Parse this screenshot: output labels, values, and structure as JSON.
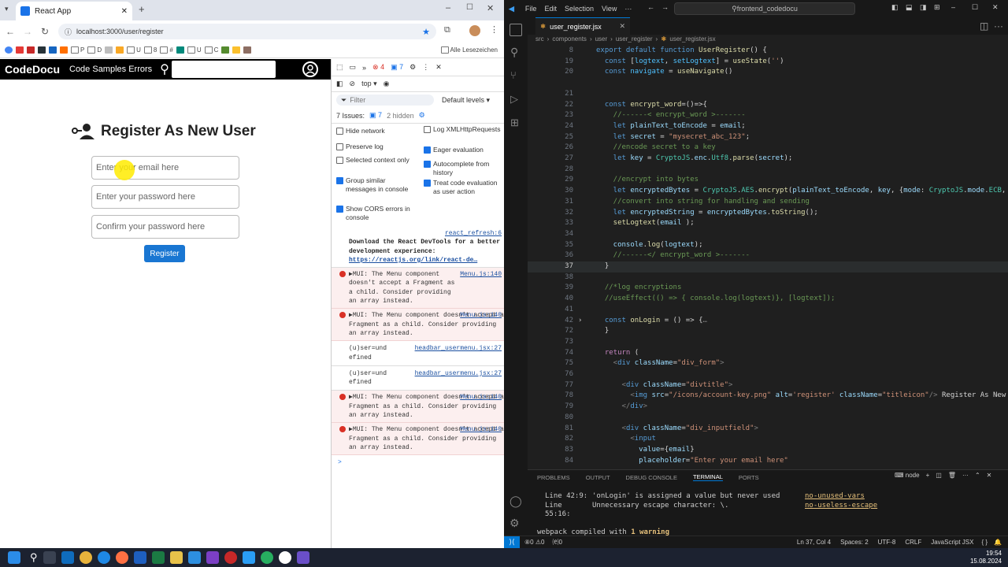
{
  "browser": {
    "tab_title": "React App",
    "url": "localhost:3000/user/register",
    "bookmarks": [
      "P",
      "D",
      "U",
      "8",
      "#",
      "U",
      "C"
    ],
    "all_bookmarks_label": "Alle Lesezeichen"
  },
  "app": {
    "brand": "CodeDocu",
    "nav_link": "Code Samples Errors",
    "register_title": "Register As New User",
    "email_placeholder": "Enter your email here",
    "password_placeholder": "Enter your password here",
    "confirm_placeholder": "Confirm your password here",
    "register_button": "Register"
  },
  "devtools": {
    "errors_count": "4",
    "messages_count": "7",
    "context": "top",
    "filter_placeholder": "Filter",
    "levels": "Default levels",
    "issues_label": "7 Issues:",
    "issues_count": "7",
    "hidden_label": "2 hidden",
    "options_left": [
      {
        "label": "Hide network",
        "checked": false
      },
      {
        "label": "Preserve log",
        "checked": false
      },
      {
        "label": "Selected context only",
        "checked": false
      },
      {
        "label": "Group similar messages in console",
        "checked": true
      },
      {
        "label": "Show CORS errors in console",
        "checked": true
      }
    ],
    "options_right": [
      {
        "label": "Log XMLHttpRequests",
        "checked": false
      },
      {
        "label": "Eager evaluation",
        "checked": true
      },
      {
        "label": "Autocomplete from history",
        "checked": true
      },
      {
        "label": "Treat code evaluation as user action",
        "checked": true
      }
    ],
    "console": {
      "info_src": "react_refresh:6",
      "info_text": "Download the React DevTools for a better development experience:",
      "info_link": "https://reactjs.org/link/react-de…",
      "mui_text": "▶MUI: The Menu component doesn't accept a Fragment as a child. Consider providing an array instead.",
      "mui_src": "Menu.js:140",
      "user_text": "(u)ser=und efined",
      "user_src": "headbar_usermenu.jsx:27",
      "prompt": ">"
    }
  },
  "vscode": {
    "menu": [
      "File",
      "Edit",
      "Selection",
      "View"
    ],
    "command_center": "frontend_codedocu",
    "tab": "user_register.jsx",
    "breadcrumb": [
      "src",
      "components",
      "user",
      "user_register",
      "user_register.jsx"
    ],
    "code_lines": [
      {
        "n": "8",
        "t": [
          [
            "kw",
            "export default function "
          ],
          [
            "fn",
            "UserRegister"
          ],
          [
            "pun",
            "() {"
          ]
        ]
      },
      {
        "n": "19",
        "t": [
          [
            "kw",
            "  const "
          ],
          [
            "pun",
            "["
          ],
          [
            "con",
            "logtext"
          ],
          [
            "pun",
            ", "
          ],
          [
            "con",
            "setLogtext"
          ],
          [
            "pun",
            "] = "
          ],
          [
            "fn",
            "useState"
          ],
          [
            "pun",
            "("
          ],
          [
            "str",
            "''"
          ],
          [
            "pun",
            ")"
          ]
        ]
      },
      {
        "n": "20",
        "t": [
          [
            "kw",
            "  const "
          ],
          [
            "con",
            "navigate"
          ],
          [
            "pun",
            " = "
          ],
          [
            "fn",
            "useNavigate"
          ],
          [
            "pun",
            "()"
          ]
        ]
      },
      {
        "n": "",
        "t": []
      },
      {
        "n": "21",
        "t": []
      },
      {
        "n": "22",
        "t": [
          [
            "kw",
            "  const "
          ],
          [
            "fn",
            "encrypt_word"
          ],
          [
            "pun",
            "=()=>{"
          ]
        ]
      },
      {
        "n": "23",
        "t": [
          [
            "cm",
            "    //------< encrypt_word >-------"
          ]
        ]
      },
      {
        "n": "24",
        "t": [
          [
            "kw",
            "    let "
          ],
          [
            "var",
            "plainText_toEncode"
          ],
          [
            "pun",
            " = "
          ],
          [
            "var",
            "email"
          ],
          [
            "pun",
            ";"
          ]
        ]
      },
      {
        "n": "25",
        "t": [
          [
            "kw",
            "    let "
          ],
          [
            "var",
            "secret"
          ],
          [
            "pun",
            " = "
          ],
          [
            "str",
            "\"mysecret_abc_123\""
          ],
          [
            "pun",
            ";"
          ]
        ]
      },
      {
        "n": "26",
        "t": [
          [
            "cm",
            "    //encode secret to a key"
          ]
        ]
      },
      {
        "n": "27",
        "t": [
          [
            "kw",
            "    let "
          ],
          [
            "var",
            "key"
          ],
          [
            "pun",
            " = "
          ],
          [
            "cls",
            "CryptoJS"
          ],
          [
            "pun",
            "."
          ],
          [
            "var",
            "enc"
          ],
          [
            "pun",
            "."
          ],
          [
            "cls",
            "Utf8"
          ],
          [
            "pun",
            "."
          ],
          [
            "fn",
            "parse"
          ],
          [
            "pun",
            "("
          ],
          [
            "var",
            "secret"
          ],
          [
            "pun",
            ");"
          ]
        ]
      },
      {
        "n": "28",
        "t": []
      },
      {
        "n": "29",
        "t": [
          [
            "cm",
            "    //encrypt into bytes"
          ]
        ]
      },
      {
        "n": "30",
        "t": [
          [
            "kw",
            "    let "
          ],
          [
            "var",
            "encryptedBytes"
          ],
          [
            "pun",
            " = "
          ],
          [
            "cls",
            "CryptoJS"
          ],
          [
            "pun",
            "."
          ],
          [
            "cls",
            "AES"
          ],
          [
            "pun",
            "."
          ],
          [
            "fn",
            "encrypt"
          ],
          [
            "pun",
            "("
          ],
          [
            "var",
            "plainText_toEncode"
          ],
          [
            "pun",
            ", "
          ],
          [
            "var",
            "key"
          ],
          [
            "pun",
            ", {"
          ],
          [
            "var",
            "mode"
          ],
          [
            "pun",
            ": "
          ],
          [
            "cls",
            "CryptoJS"
          ],
          [
            "pun",
            "."
          ],
          [
            "var",
            "mode"
          ],
          [
            "pun",
            "."
          ],
          [
            "cls",
            "ECB"
          ],
          [
            "pun",
            ", "
          ],
          [
            "var",
            "paddi"
          ]
        ]
      },
      {
        "n": "31",
        "t": [
          [
            "cm",
            "    //convert into string for handling and sending"
          ]
        ]
      },
      {
        "n": "32",
        "t": [
          [
            "kw",
            "    let "
          ],
          [
            "var",
            "encryptedString"
          ],
          [
            "pun",
            " = "
          ],
          [
            "var",
            "encryptedBytes"
          ],
          [
            "pun",
            "."
          ],
          [
            "fn",
            "toString"
          ],
          [
            "pun",
            "();"
          ]
        ]
      },
      {
        "n": "33",
        "t": [
          [
            "fn",
            "    setLogtext"
          ],
          [
            "pun",
            "("
          ],
          [
            "var",
            "email"
          ],
          [
            "pun",
            " );"
          ]
        ]
      },
      {
        "n": "34",
        "t": []
      },
      {
        "n": "35",
        "t": [
          [
            "var",
            "    console"
          ],
          [
            "pun",
            "."
          ],
          [
            "fn",
            "log"
          ],
          [
            "pun",
            "("
          ],
          [
            "var",
            "logtext"
          ],
          [
            "pun",
            ");"
          ]
        ]
      },
      {
        "n": "36",
        "t": [
          [
            "cm",
            "    //------</ encrypt_word >-------"
          ]
        ]
      },
      {
        "n": "37",
        "t": [
          [
            "pun",
            "  }"
          ]
        ],
        "cur": true
      },
      {
        "n": "38",
        "t": []
      },
      {
        "n": "39",
        "t": [
          [
            "cm",
            "  //*log encryptions"
          ]
        ]
      },
      {
        "n": "40",
        "t": [
          [
            "cm",
            "  //useEffect(() => { console.log(logtext)}, [logtext]);"
          ]
        ]
      },
      {
        "n": "41",
        "t": []
      },
      {
        "n": "42",
        "t": [
          [
            "kw",
            "  const "
          ],
          [
            "fn",
            "onLogin"
          ],
          [
            "pun",
            " = () => {"
          ],
          [
            "tagb",
            "…"
          ]
        ],
        "fold": true
      },
      {
        "n": "72",
        "t": [
          [
            "pun",
            "  }"
          ]
        ]
      },
      {
        "n": "73",
        "t": []
      },
      {
        "n": "74",
        "t": [
          [
            "ctl",
            "  return "
          ],
          [
            "pun",
            "("
          ]
        ]
      },
      {
        "n": "75",
        "t": [
          [
            "tagb",
            "    <"
          ],
          [
            "tag",
            "div "
          ],
          [
            "var",
            "className"
          ],
          [
            "pun",
            "="
          ],
          [
            "str",
            "\"div_form\""
          ],
          [
            "tagb",
            ">"
          ]
        ]
      },
      {
        "n": "76",
        "t": []
      },
      {
        "n": "77",
        "t": [
          [
            "tagb",
            "      <"
          ],
          [
            "tag",
            "div "
          ],
          [
            "var",
            "className"
          ],
          [
            "pun",
            "="
          ],
          [
            "str",
            "\"divtitle\""
          ],
          [
            "tagb",
            ">"
          ]
        ]
      },
      {
        "n": "78",
        "t": [
          [
            "tagb",
            "        <"
          ],
          [
            "tag",
            "img "
          ],
          [
            "var",
            "src"
          ],
          [
            "pun",
            "="
          ],
          [
            "str",
            "\"/icons/account-key.png\""
          ],
          [
            "var",
            " alt"
          ],
          [
            "pun",
            "="
          ],
          [
            "str",
            "'register'"
          ],
          [
            "var",
            " className"
          ],
          [
            "pun",
            "="
          ],
          [
            "str",
            "\"titleicon\""
          ],
          [
            "tagb",
            "/>"
          ],
          [
            "pun",
            " Register As New Use"
          ]
        ]
      },
      {
        "n": "79",
        "t": [
          [
            "tagb",
            "      </"
          ],
          [
            "tag",
            "div"
          ],
          [
            "tagb",
            ">"
          ]
        ]
      },
      {
        "n": "80",
        "t": []
      },
      {
        "n": "81",
        "t": [
          [
            "tagb",
            "      <"
          ],
          [
            "tag",
            "div "
          ],
          [
            "var",
            "className"
          ],
          [
            "pun",
            "="
          ],
          [
            "str",
            "\"div_inputfield\""
          ],
          [
            "tagb",
            ">"
          ]
        ]
      },
      {
        "n": "82",
        "t": [
          [
            "tagb",
            "        <"
          ],
          [
            "tag",
            "input"
          ]
        ]
      },
      {
        "n": "83",
        "t": [
          [
            "var",
            "          value"
          ],
          [
            "pun",
            "={"
          ],
          [
            "var",
            "email"
          ],
          [
            "pun",
            "}"
          ]
        ]
      },
      {
        "n": "84",
        "t": [
          [
            "var",
            "          placeholder"
          ],
          [
            "pun",
            "="
          ],
          [
            "str",
            "\"Enter your email here\""
          ]
        ]
      }
    ],
    "panel_tabs": [
      "PROBLEMS",
      "OUTPUT",
      "DEBUG CONSOLE",
      "TERMINAL",
      "PORTS"
    ],
    "panel_active": "TERMINAL",
    "terminal_shell": "node",
    "terminal": [
      {
        "loc": "Line 42:9:",
        "msg": "'onLogin' is assigned a value but never used",
        "rule": "no-unused-vars"
      },
      {
        "loc": "Line 55:16:",
        "msg": "Unnecessary escape character: \\.",
        "rule": "no-useless-escape"
      }
    ],
    "compiled_prefix": "webpack compiled with ",
    "compiled_warning": "1 warning",
    "status": {
      "errors": "⑧0 ⚠0",
      "ports": "⒠0",
      "position": "Ln 37, Col 4",
      "spaces": "Spaces: 2",
      "encoding": "UTF-8",
      "eol": "CRLF",
      "language": "JavaScript JSX"
    }
  },
  "taskbar": {
    "time": "19:54",
    "date": "15.08.2024"
  }
}
